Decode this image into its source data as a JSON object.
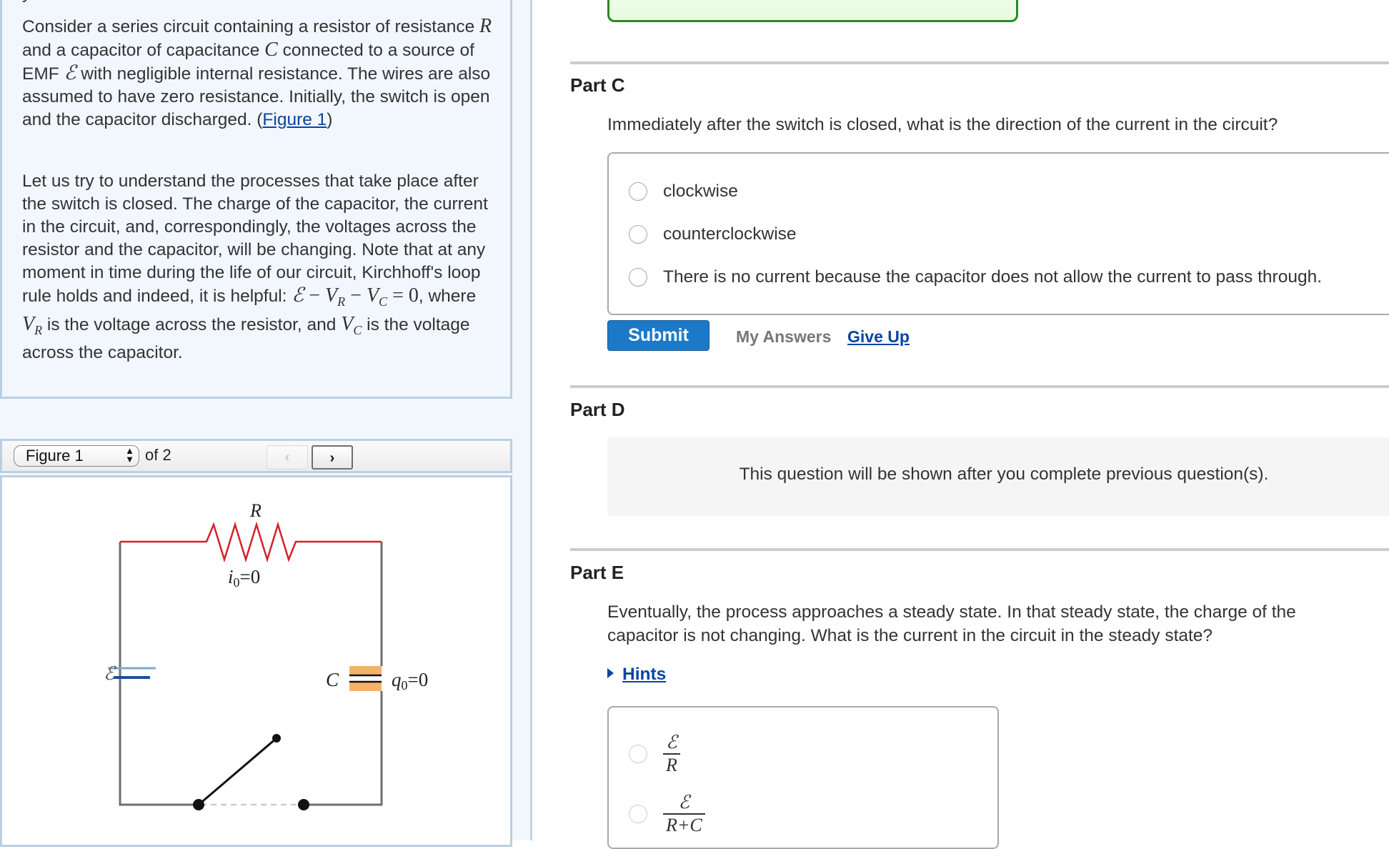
{
  "intro": {
    "cut_top_text": "y",
    "p1": {
      "t1": "Consider a series circuit containing a resistor of resistance ",
      "R": "R",
      "t2": " and a capacitor of capacitance ",
      "C": "C",
      "t3": " connected to a source of EMF ",
      "emf": "ℰ",
      "t4": " with negligible internal resistance. The wires are also assumed to have zero resistance. Initially, the switch is open and the capacitor discharged. (",
      "link": "Figure 1",
      "t5": ")"
    },
    "p2": {
      "t1": "Let us try to understand the processes that take place after the switch is closed. The charge of the capacitor, the current in the circuit, and, correspondingly, the voltages across the resistor and the capacitor, will be changing. Note that at any moment in time during the life of our circuit, Kirchhoff's loop rule holds and indeed, it is helpful: ",
      "eq_emf": "ℰ",
      "eq_minus1": " − ",
      "eq_V1": "V",
      "eq_sub1": "R",
      "eq_minus2": " − ",
      "eq_V2": "V",
      "eq_sub2": "C",
      "eq_rest": " = 0",
      "t2": ", where ",
      "V3": "V",
      "sub3": "R",
      "t3": " is the voltage across the resistor, and ",
      "V4": "V",
      "sub4": "C",
      "t4": " is the voltage across the capacitor."
    }
  },
  "figure": {
    "select_value": "Figure 1",
    "of_label": "of 2",
    "prev_label": "‹",
    "next_label": "›",
    "labels": {
      "resistor": "R",
      "current": "i",
      "current_sub": "0",
      "current_eq": "=0",
      "emf": "ℰ",
      "capacitor": "C",
      "charge": "q",
      "charge_sub": "0",
      "charge_eq": "=0"
    },
    "colors": {
      "wire": "#6e6e6e",
      "resistor": "#d2232a",
      "battery_long": "#7fa8d8",
      "battery_short": "#1f4e9c",
      "capacitor": "#f5b26b",
      "switch": "#111111"
    }
  },
  "partC": {
    "heading": "Part C",
    "question": "Immediately after the switch is closed, what is the direction of the current in the circuit?",
    "options": [
      "clockwise",
      "counterclockwise",
      "There is no current because the capacitor does not allow the current to pass through."
    ],
    "submit_label": "Submit",
    "my_answers_label": "My Answers",
    "give_up_label": "Give Up"
  },
  "partD": {
    "heading": "Part D",
    "locked_message": "This question will be shown after you complete previous question(s)."
  },
  "partE": {
    "heading": "Part E",
    "question": "Eventually, the process approaches a steady state. In that steady state, the charge of the capacitor is not changing. What is the current in the circuit in the steady state?",
    "hints_label": "Hints",
    "options": [
      {
        "num": "ℰ",
        "den": "R"
      },
      {
        "num": "ℰ",
        "den": "R+C"
      }
    ]
  },
  "colors": {
    "accent_blue": "#1b79c8",
    "link_blue": "#0a45a0",
    "success_green": "#2a8a22",
    "panel_bg": "#f2f7fe"
  }
}
